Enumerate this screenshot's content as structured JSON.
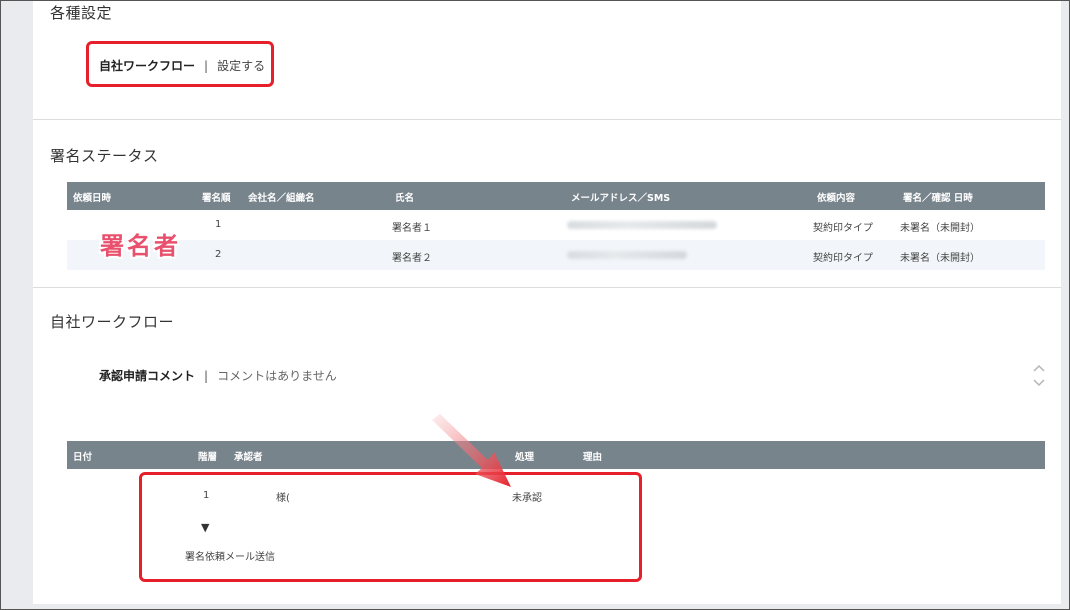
{
  "settings": {
    "title": "各種設定",
    "workflow_label": "自社ワークフロー",
    "separator": "|",
    "action_link": "設定する"
  },
  "signature_status": {
    "title": "署名ステータス",
    "overlay_label": "署名者",
    "columns": [
      "依頼日時",
      "署名順",
      "会社名／組織名",
      "氏名",
      "メールアドレス／SMS",
      "依頼内容",
      "署名／確認 日時"
    ],
    "rows": [
      {
        "order": "1",
        "name": "署名者１",
        "request": "契約印タイプ",
        "status": "未署名（未開封）"
      },
      {
        "order": "2",
        "name": "署名者２",
        "request": "契約印タイプ",
        "status": "未署名（未開封）"
      }
    ]
  },
  "workflow": {
    "title": "自社ワークフロー",
    "comment_label": "承認申請コメント",
    "separator": "|",
    "comment_value": "コメントはありません",
    "columns": [
      "日付",
      "階層",
      "承認者",
      "処理",
      "理由"
    ],
    "row": {
      "level": "1",
      "approver": "様(",
      "process": "未承認"
    },
    "step_arrow": "▼",
    "step_label": "署名依頼メール送信"
  },
  "colors": {
    "table_header": "#78848c",
    "highlight_red": "#e5202a",
    "overlay_pink": "#e8506e"
  }
}
